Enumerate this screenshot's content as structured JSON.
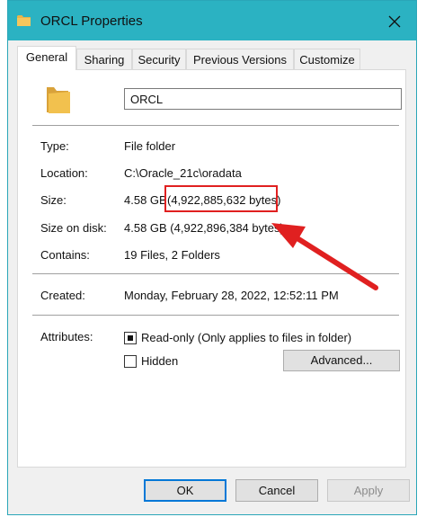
{
  "window": {
    "title": "ORCL Properties"
  },
  "tabs": [
    {
      "label": "General"
    },
    {
      "label": "Sharing"
    },
    {
      "label": "Security"
    },
    {
      "label": "Previous Versions"
    },
    {
      "label": "Customize"
    }
  ],
  "general": {
    "name_value": "ORCL",
    "type": {
      "label": "Type:",
      "value": "File folder"
    },
    "location": {
      "label": "Location:",
      "value": "C:\\Oracle_21c\\oradata"
    },
    "size": {
      "label": "Size:",
      "value_gb": "4.58 GB",
      "value_bytes": "(4,922,885,632 bytes)"
    },
    "size_on_disk": {
      "label": "Size on disk:",
      "value": "4.58 GB (4,922,896,384 bytes)"
    },
    "contains": {
      "label": "Contains:",
      "value": "19 Files, 2 Folders"
    },
    "created": {
      "label": "Created:",
      "value": "Monday, February 28, 2022, 12:52:11 PM"
    },
    "attributes": {
      "label": "Attributes:",
      "readonly": {
        "label": "Read-only (Only applies to files in folder)",
        "state": "indeterminate"
      },
      "hidden": {
        "label": "Hidden",
        "checked": false
      },
      "advanced_label": "Advanced..."
    }
  },
  "buttons": {
    "ok": "OK",
    "cancel": "Cancel",
    "apply": "Apply"
  },
  "colors": {
    "titlebar": "#2bb2c2",
    "highlight": "#e02020",
    "folder": "#e8b54a",
    "ok_border": "#0078d7"
  }
}
